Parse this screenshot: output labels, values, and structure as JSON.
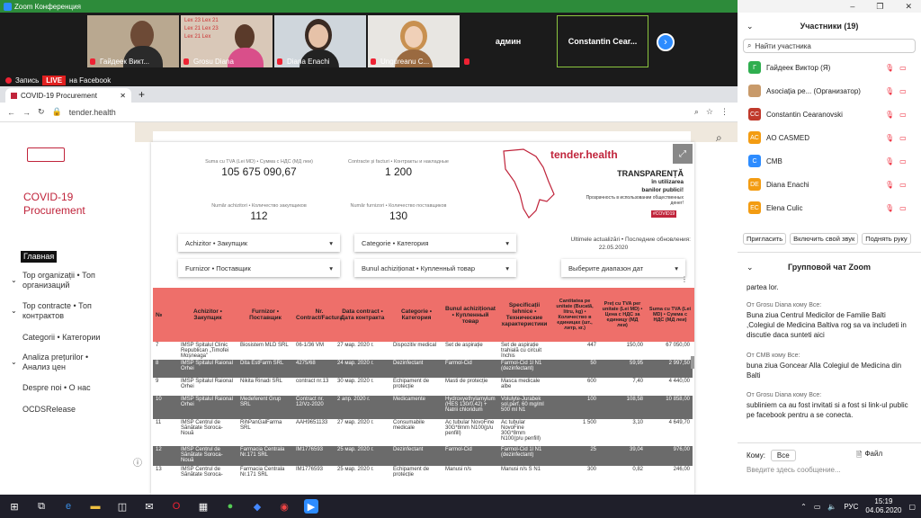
{
  "zoom": {
    "title": "Zoom Конференция",
    "window_controls": [
      "–",
      "❐",
      "✕"
    ],
    "tiles": [
      {
        "name": "Гайдеек Викт..."
      },
      {
        "name": "Grosu Diana"
      },
      {
        "name": "Diana Enachi"
      },
      {
        "name": "Ungureanu C..."
      },
      {
        "name": "админ"
      },
      {
        "name": "Constantin Cear..."
      }
    ],
    "recording": "Запись",
    "live": "LIVE",
    "live_on": "на Facebook"
  },
  "browser": {
    "tab_title": "COVID-19 Procurement",
    "url": "tender.health"
  },
  "site": {
    "brand_line1": "COVID-19",
    "brand_line2": "Procurement",
    "nav": [
      {
        "label": "Главная"
      },
      {
        "label": "Top organizații • Топ организаций"
      },
      {
        "label": "Top contracte • Топ контрактов"
      },
      {
        "label": "Categorii • Категории"
      },
      {
        "label": "Analiza prețurilor • Анализ цен"
      },
      {
        "label": "Despre noi • О нас"
      },
      {
        "label": "OCDSRelease"
      }
    ],
    "stats": [
      {
        "label": "Suma cu TVA (Lei MD) • Сумма с НДС (МД леи)",
        "value": "105 675 090,67"
      },
      {
        "label": "Contracte și facturi • Контракты и накладные",
        "value": "1 200"
      },
      {
        "label": "Număr achizitori • Количество закупщиков",
        "value": "112"
      },
      {
        "label": "Număr furnizori • Количество поставщиков",
        "value": "130"
      }
    ],
    "logo_text": "tender.health",
    "slogan1": "TRANSPARENȚĂ",
    "slogan2": "în utilizarea",
    "slogan3": "banilor publici!",
    "slogan4": "Прозрачность в использовании общественных денег!",
    "hashtag": "#COVID19",
    "updated_label": "Ultimele actualizări • Последние обновления:",
    "updated_date": "22.05.2020",
    "filters": {
      "buyer": "Achizitor • Закупщик",
      "category": "Categorie • Категория",
      "supplier": "Furnizor • Поставщик",
      "item": "Bunul achiziționat • Купленный товар",
      "date_range": "Выберите диапазон дат"
    },
    "columns": [
      "№",
      "Achizitor • Закупщик",
      "Furnizor • Поставщик",
      "Nr. Contract/Factura",
      "Data contract • Дата контракта",
      "Categorie • Категория",
      "Bunul achiziționat • Купленный товар",
      "Specificații tehnice • Технические характеристики",
      "Cantitatea pe unitate (Bucată, litru, kg) • Количество в единицах (шт., литр, кг.)",
      "Preț cu TVA per unitate (Lei MD) • Цена с НДС за единицу (МД леи)",
      "Suma cu TVA (Lei MD) • Сумма с НДС (МД леи)"
    ],
    "rows": [
      {
        "n": "7",
        "buyer": "IMSP Spitalul Clinic Republican „Timofei Moșneaga”",
        "supplier": "Biosistem MLD SRL",
        "nr": "06-1/36 VM",
        "date": "27 мар. 2020 г.",
        "cat": "Dispozitiv medical",
        "item": "Set de aspirație",
        "spec": "Set de aspirație trahială cu circuit închis",
        "qty": "447",
        "price": "150,00",
        "sum": "67 050,00",
        "dark": false
      },
      {
        "n": "8",
        "buyer": "IMSP Spitalul Raional Orhei",
        "supplier": "Dita EstFarm SRL",
        "nr": "4275/68",
        "date": "24 мар. 2020 г.",
        "cat": "Dezinfectant",
        "item": "Farmol-Cid",
        "spec": "Farmol-Cid 1l N1 (dezinfectant)",
        "qty": "50",
        "price": "59,95",
        "sum": "2 997,50",
        "dark": true
      },
      {
        "n": "9",
        "buyer": "IMSP Spitalul Raional Orhei",
        "supplier": "Nikita Rinadi SRL",
        "nr": "contract nr.13",
        "date": "30 мар. 2020 г.",
        "cat": "Echipament de protecție",
        "item": "Masti de protecție",
        "spec": "Masca medicale albe",
        "qty": "600",
        "price": "7,40",
        "sum": "4 440,00",
        "dark": false
      },
      {
        "n": "10",
        "buyer": "IMSP Spitalul Raional Orhei",
        "supplier": "Medeferent Grup SRL",
        "nr": "Contract nr. 12/Vz-2020",
        "date": "2 апр. 2020 г.",
        "cat": "Medicamente",
        "item": "Hydroxyethylamylum (HES 130/0,42) + Natrii chloridum",
        "spec": "Volulyte-Jurabek sol.perf. 60 mg/ml 500 ml N1",
        "qty": "100",
        "price": "108,58",
        "sum": "10 858,00",
        "dark": true
      },
      {
        "n": "11",
        "buyer": "IMSP Centrul de Sănătate Soroca-Nouă",
        "supplier": "RihPanGalFarma SRL",
        "nr": "AAH9651133",
        "date": "27 мар. 2020 г.",
        "cat": "Consumabile medicale",
        "item": "Ac tubular NovoFine 30G*8mm N100(p/u penfill)",
        "spec": "Ac tubular NovoFine 30G*8mm N100(p/u penfill)",
        "qty": "1 500",
        "price": "3,10",
        "sum": "4 649,70",
        "dark": false
      },
      {
        "n": "12",
        "buyer": "IMSP Centrul de Sănătate Soroca-Nouă",
        "supplier": "Farmacia Centrala Nr.171 SRL",
        "nr": "IM1776593",
        "date": "25 мар. 2020 г.",
        "cat": "Dezinfectant",
        "item": "Farmol-Cid",
        "spec": "Farmol-Cid 1l N1 (dezinfectant)",
        "qty": "25",
        "price": "39,04",
        "sum": "976,00",
        "dark": true
      },
      {
        "n": "13",
        "buyer": "IMSP Centrul de Sănătate Soroca-Nouă",
        "supplier": "Farmacia Centrala Nr.171 SRL",
        "nr": "IM1776593",
        "date": "25 мар. 2020 г.",
        "cat": "Echipament de protecție",
        "item": "Manusi n/s",
        "spec": "Manusi n/s S N1",
        "qty": "300",
        "price": "0,82",
        "sum": "246,00",
        "dark": false
      }
    ]
  },
  "participants": {
    "title": "Участники (19)",
    "search_placeholder": "Найти участника",
    "list": [
      {
        "initial": "Г",
        "name": "Гайдеек Виктор (Я)",
        "color": "#2fae4f"
      },
      {
        "initial": "",
        "name": "Asociația pe... (Организатор)",
        "color": "#c89a6a"
      },
      {
        "initial": "CC",
        "name": "Constantin Cearanovski",
        "color": "#c0392b"
      },
      {
        "initial": "AC",
        "name": "AO CASMED",
        "color": "#f39c12"
      },
      {
        "initial": "C",
        "name": "CMB",
        "color": "#2d8cff"
      },
      {
        "initial": "DE",
        "name": "Diana Enachi",
        "color": "#f39c12"
      },
      {
        "initial": "EC",
        "name": "Elena Culic",
        "color": "#f39c12"
      }
    ],
    "invite": "Пригласить",
    "unmute": "Включить свой звук",
    "raise_hand": "Поднять руку"
  },
  "chat": {
    "title": "Групповой чат Zoom",
    "partial": "partea lor.",
    "messages": [
      {
        "from": "От Grosu Diana кому Все:",
        "text": "Buna ziua Centrul Medicilor de Familie Balti ,Colegiul de Medicina Baltiva rog sa va includeti in discutie daca sunteti aici"
      },
      {
        "from": "От CMB кому Все:",
        "text": "buna ziua Goncear Alla Colegiul de Medicina din Balti"
      },
      {
        "from": "От Grosu Diana кому Все:",
        "text": "subliniem ca au fost invitati si a fost si link-ul public pe facebook pentru a se conecta."
      }
    ],
    "to_label": "Кому:",
    "to_value": "Все",
    "file_label": "Файл",
    "input_placeholder": "Введите здесь сообщение..."
  },
  "taskbar": {
    "time": "15:19",
    "date": "04.06.2020",
    "lang": "РУС"
  }
}
